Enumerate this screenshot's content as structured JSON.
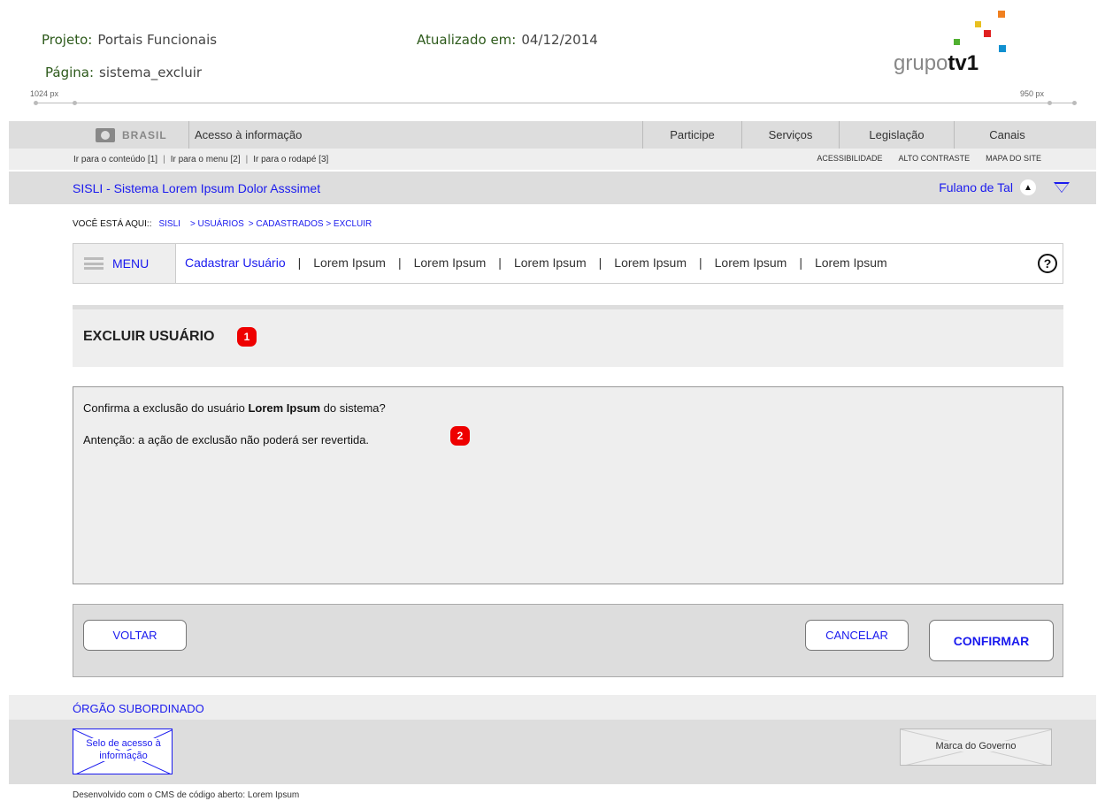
{
  "doc": {
    "projeto_label": "Projeto:",
    "projeto_value": "Portais Funcionais",
    "pagina_label": "Página:",
    "pagina_value": "sistema_excluir",
    "atualizado_label": "Atualizado em:",
    "atualizado_value": "04/12/2014",
    "logo_text_a": "grupo",
    "logo_text_b": "tv1",
    "ruler_left": "1024 px",
    "ruler_right": "950 px"
  },
  "govbar": {
    "brasil": "BRASIL",
    "acesso": "Acesso à informação",
    "nav": [
      "Participe",
      "Serviços",
      "Legislação",
      "Canais"
    ]
  },
  "skip": {
    "links": [
      "Ir para o conteúdo [1]",
      "Ir para o menu [2]",
      "Ir para o rodapé [3]"
    ],
    "acc": [
      "ACESSIBILIDADE",
      "ALTO CONTRASTE",
      "MAPA DO SITE"
    ]
  },
  "system": {
    "title": "SISLI - Sistema Lorem Ipsum Dolor Asssimet",
    "user": "Fulano de Tal"
  },
  "breadcrumb": {
    "label": "VOCÊ ESTÁ AQUI::",
    "items": [
      "SISLI",
      "> USUÁRIOS",
      "> CADASTRADOS > EXCLUIR"
    ]
  },
  "menu": {
    "label": "MENU",
    "items": [
      "Cadastrar Usuário",
      "Lorem Ipsum",
      "Lorem Ipsum",
      "Lorem Ipsum",
      "Lorem Ipsum",
      "Lorem Ipsum",
      "Lorem Ipsum"
    ],
    "separator": "|",
    "help": "?"
  },
  "page": {
    "title": "EXCLUIR USUÁRIO",
    "badge1": "1",
    "badge2": "2",
    "confirm_pre": "Confirma a exclusão do usuário ",
    "confirm_bold": "Lorem Ipsum",
    "confirm_post": " do sistema?",
    "warning": "Antenção: a ação de exclusão não poderá ser revertida."
  },
  "buttons": {
    "voltar": "VOLTAR",
    "cancelar": "CANCELAR",
    "confirmar": "CONFIRMAR"
  },
  "footer": {
    "orgao": "ÓRGÃO SUBORDINADO",
    "selo_line1": "Selo de acesso à",
    "selo_line2": "informação",
    "marca": "Marca do Governo",
    "developed": "Desenvolvido com o CMS de código aberto: Lorem Ipsum"
  },
  "colors": {
    "link": "#1a1aee",
    "badge": "#ee0000",
    "doc_label": "#2d5a1b"
  }
}
